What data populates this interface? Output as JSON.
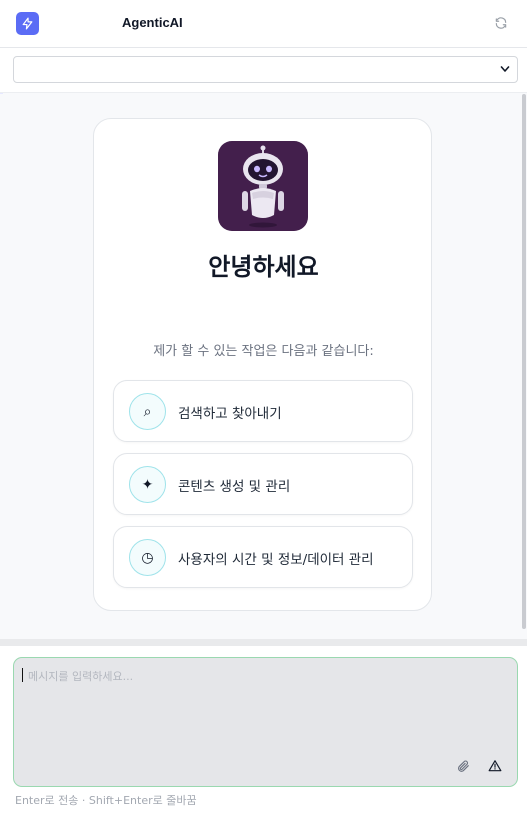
{
  "header": {
    "title": "AgenticAI",
    "logo_icon": "lightning-icon",
    "refresh_icon": "refresh-icon",
    "accent_color": "#5b6cf5"
  },
  "selector": {
    "value": "",
    "icon": "chevron-down-icon"
  },
  "welcome": {
    "avatar_icon": "robot-avatar",
    "greeting": "안녕하세요",
    "subtitle": "제가 할 수 있는 작업은 다음과 같습니다:",
    "options": [
      {
        "icon": "search-icon",
        "glyph": "⌕",
        "label": "검색하고 찾아내기"
      },
      {
        "icon": "sparkle-icon",
        "glyph": "✦",
        "label": "콘텐츠 생성 및 관리"
      },
      {
        "icon": "clock-icon",
        "glyph": "◷",
        "label": "사용자의 시간 및 정보/데이터 관리"
      }
    ]
  },
  "composer": {
    "placeholder": "메시지를 입력하세요...",
    "attach_icon": "paperclip-icon",
    "warning_icon": "warning-icon",
    "hint": "Enter로 전송 · Shift+Enter로 줄바꿈",
    "border_color": "#9ad8b0"
  }
}
